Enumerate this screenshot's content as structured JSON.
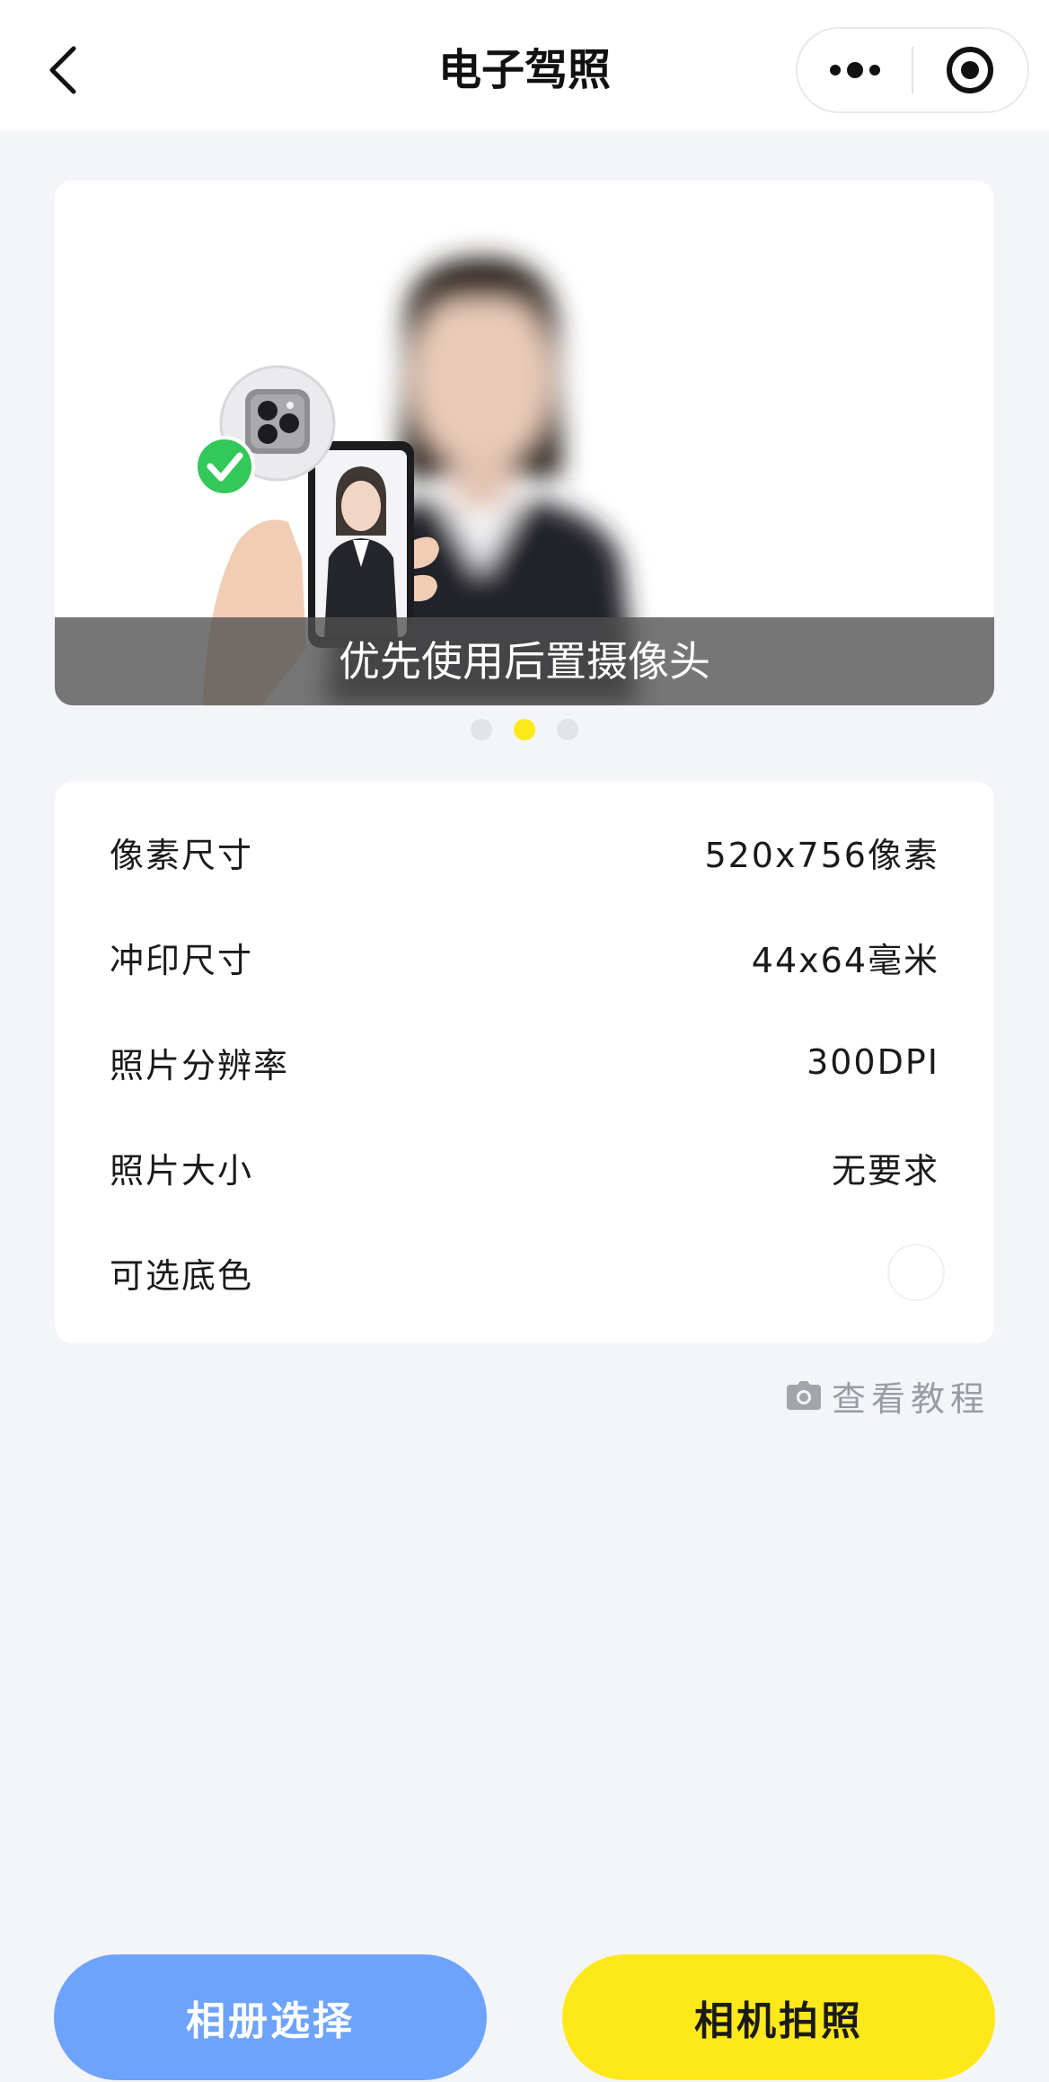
{
  "header": {
    "title": "电子驾照",
    "icons": {
      "back": "chevron-left-icon",
      "more": "more-dots-icon",
      "close": "target-circle-icon"
    }
  },
  "banner": {
    "caption": "优先使用后置摄像头",
    "slide_count": 3,
    "active_slide": 2
  },
  "specs": [
    {
      "label": "像素尺寸",
      "value": "520x756像素"
    },
    {
      "label": "冲印尺寸",
      "value": "44x64毫米"
    },
    {
      "label": "照片分辨率",
      "value": "300DPI"
    },
    {
      "label": "照片大小",
      "value": "无要求"
    },
    {
      "label": "可选底色",
      "value": "",
      "swatch_color": "#ffffff"
    }
  ],
  "tutorial": {
    "label": "查看教程",
    "icon": "camera-icon"
  },
  "buttons": {
    "album": "相册选择",
    "camera": "相机拍照"
  },
  "colors": {
    "accent_yellow": "#fde81a",
    "accent_blue": "#6ea3fb",
    "success_green": "#34c759",
    "background": "#f4f5f9"
  }
}
